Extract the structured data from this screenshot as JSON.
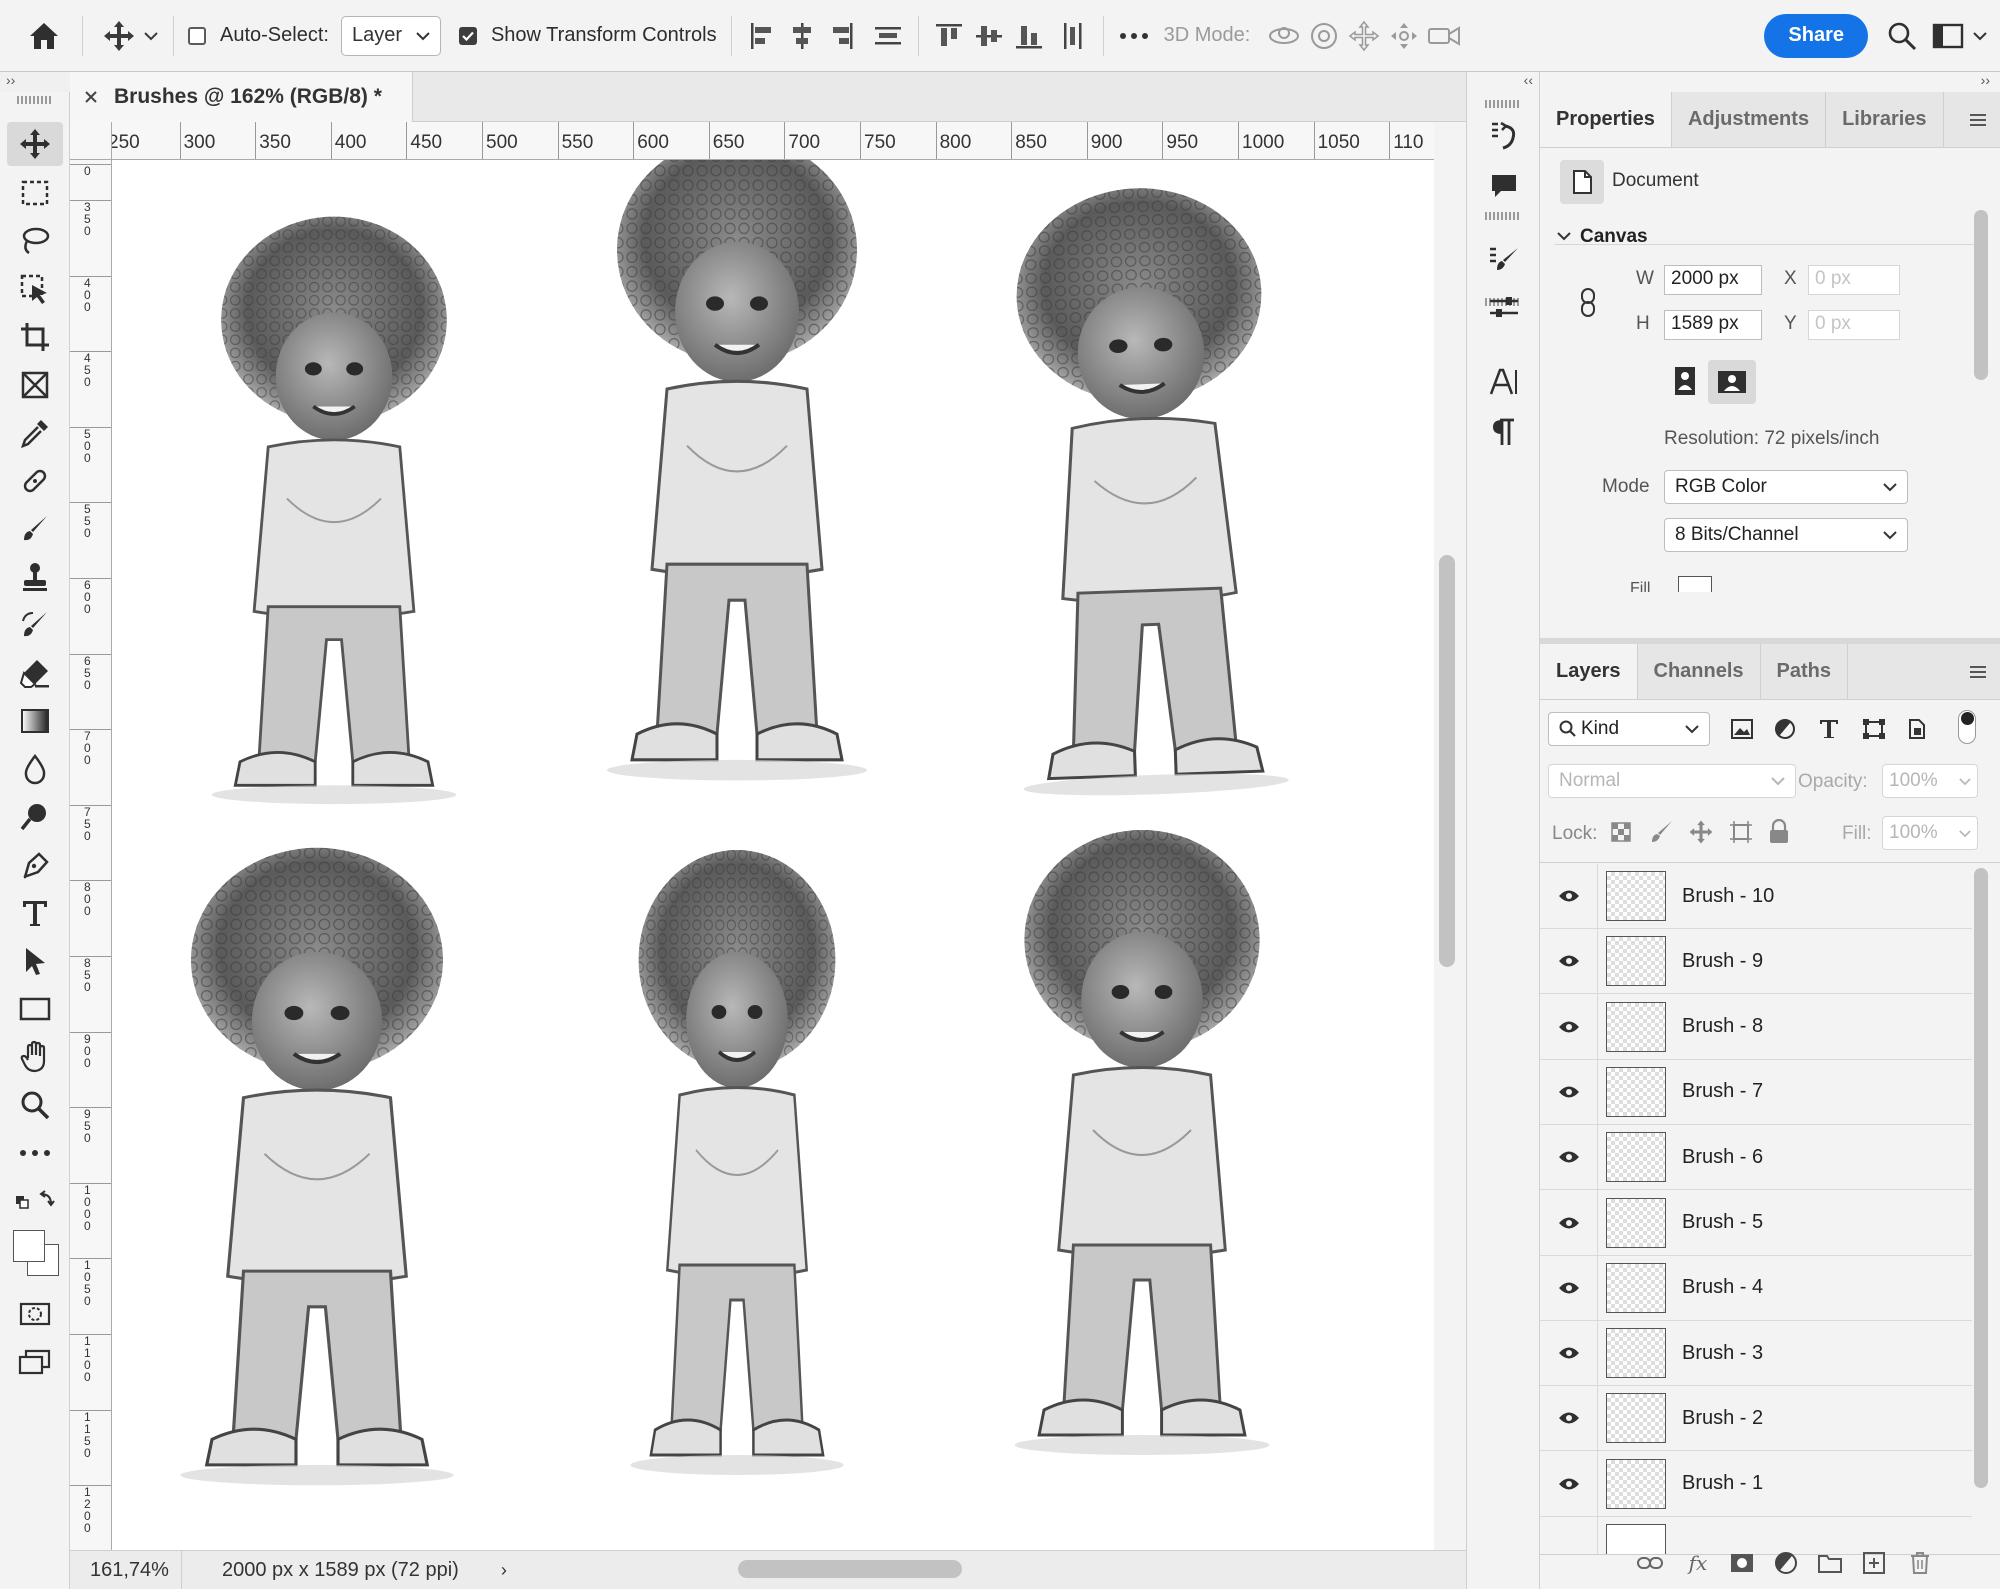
{
  "options_bar": {
    "auto_select_label": "Auto-Select:",
    "auto_select_checked": false,
    "auto_select_target": "Layer",
    "show_transform_label": "Show Transform Controls",
    "show_transform_checked": true,
    "mode_3d_label": "3D Mode:",
    "share_label": "Share"
  },
  "document": {
    "tab_title": "Brushes @ 162% (RGB/8) *",
    "zoom": "161,74%",
    "info": "2000 px x 1589 px (72 ppi)"
  },
  "rulers": {
    "top": [
      "250",
      "300",
      "350",
      "400",
      "450",
      "500",
      "550",
      "600",
      "650",
      "700",
      "750",
      "800",
      "850",
      "900",
      "950",
      "1000",
      "1050",
      "110"
    ],
    "left": [
      "0",
      "350",
      "400",
      "450",
      "500",
      "550",
      "600",
      "650",
      "700",
      "750",
      "800",
      "850",
      "900",
      "950",
      "1000",
      "1050",
      "1100",
      "1150",
      "1200"
    ]
  },
  "properties_panel": {
    "tabs": [
      "Properties",
      "Adjustments",
      "Libraries"
    ],
    "active_tab": "Properties",
    "document_label": "Document",
    "canvas_section": "Canvas",
    "width_label": "W",
    "width_value": "2000 px",
    "height_label": "H",
    "height_value": "1589 px",
    "x_label": "X",
    "x_value": "0 px",
    "y_label": "Y",
    "y_value": "0 px",
    "resolution": "Resolution: 72 pixels/inch",
    "mode_label": "Mode",
    "mode_value": "RGB Color",
    "bits_value": "8 Bits/Channel",
    "fill_label": "Fill"
  },
  "layers_panel": {
    "tabs": [
      "Layers",
      "Channels",
      "Paths"
    ],
    "active_tab": "Layers",
    "filter_kind": "Kind",
    "blend_mode": "Normal",
    "opacity_label": "Opacity:",
    "opacity_value": "100%",
    "lock_label": "Lock:",
    "fill_label": "Fill:",
    "fill_value": "100%",
    "layers": [
      {
        "name": "Brush - 10",
        "visible": true
      },
      {
        "name": "Brush - 9",
        "visible": true
      },
      {
        "name": "Brush - 8",
        "visible": true
      },
      {
        "name": "Brush - 7",
        "visible": true
      },
      {
        "name": "Brush - 6",
        "visible": true
      },
      {
        "name": "Brush - 5",
        "visible": true
      },
      {
        "name": "Brush - 4",
        "visible": true
      },
      {
        "name": "Brush - 3",
        "visible": true
      },
      {
        "name": "Brush - 2",
        "visible": true
      },
      {
        "name": "Brush - 1",
        "visible": true
      }
    ],
    "footer_fx": "fx"
  },
  "colors": {
    "accent": "#1473e6",
    "panel_bg": "#f3f3f3",
    "canvas_bg": "#ffffff"
  }
}
